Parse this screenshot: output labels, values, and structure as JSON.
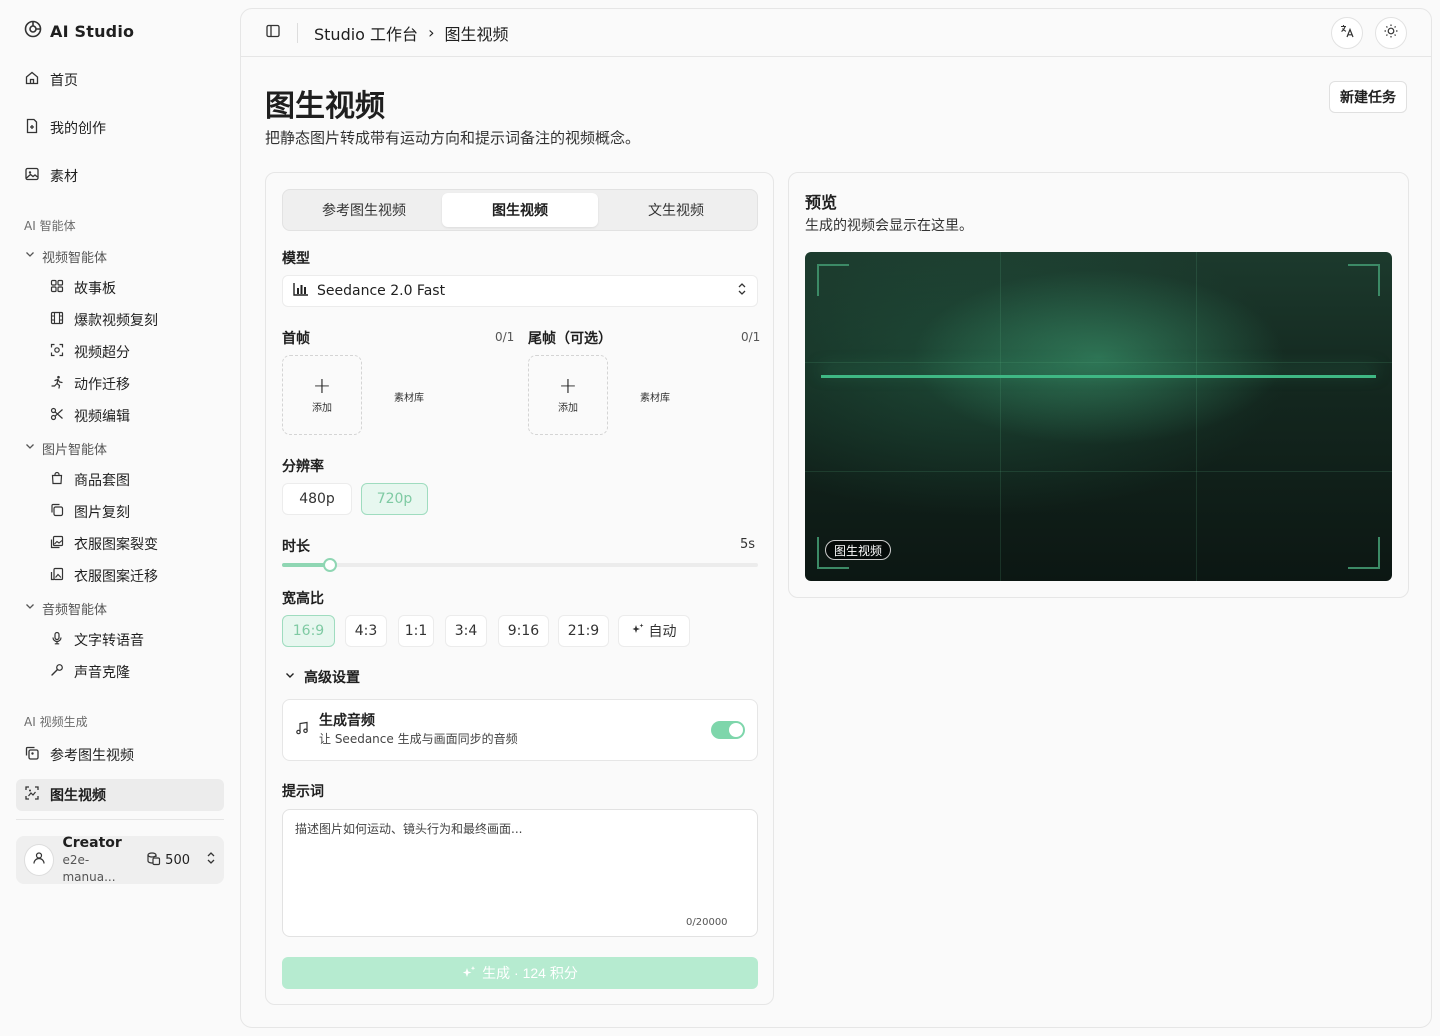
{
  "app": {
    "name": "AI Studio"
  },
  "sidebar": {
    "top_items": [
      {
        "label": "首页",
        "icon": "home-icon"
      },
      {
        "label": "我的创作",
        "icon": "file-icon"
      },
      {
        "label": "素材",
        "icon": "image-icon"
      }
    ],
    "section_ai_agents": "AI 智能体",
    "groups": [
      {
        "label": "视频智能体",
        "items": [
          "故事板",
          "爆款视频复刻",
          "视频超分",
          "动作迁移",
          "视频编辑"
        ]
      },
      {
        "label": "图片智能体",
        "items": [
          "商品套图",
          "图片复刻",
          "衣服图案裂变",
          "衣服图案迁移"
        ]
      },
      {
        "label": "音频智能体",
        "items": [
          "文字转语音",
          "声音克隆"
        ]
      }
    ],
    "section_video_gen": "AI 视频生成",
    "video_gen_items": [
      {
        "label": "参考图生视频",
        "icon": "copy-icon",
        "active": false
      },
      {
        "label": "图生视频",
        "icon": "image-scan-icon",
        "active": true
      }
    ],
    "user": {
      "name": "Creator",
      "email": "e2e-manua...",
      "credits": "500"
    }
  },
  "topbar": {
    "breadcrumb": [
      "Studio 工作台",
      "图生视频"
    ],
    "separator": "›"
  },
  "page": {
    "title": "图生视频",
    "description": "把静态图片转成带有运动方向和提示词备注的视频概念。",
    "new_task_label": "新建任务"
  },
  "form": {
    "tabs": [
      {
        "label": "参考图生视频",
        "active": false
      },
      {
        "label": "图生视频",
        "active": true
      },
      {
        "label": "文生视频",
        "active": false
      }
    ],
    "model_label": "模型",
    "model_value": "Seedance 2.0 Fast",
    "first_frame": {
      "label": "首帧",
      "count": "0/1",
      "add": "添加",
      "library": "素材库"
    },
    "last_frame": {
      "label": "尾帧（可选）",
      "count": "0/1",
      "add": "添加",
      "library": "素材库"
    },
    "resolution_label": "分辨率",
    "resolutions": [
      {
        "label": "480p",
        "selected": false
      },
      {
        "label": "720p",
        "selected": true
      }
    ],
    "duration_label": "时长",
    "duration_value": "5s",
    "duration_fraction": 0.1,
    "aspect_label": "宽高比",
    "aspects": [
      {
        "label": "16:9",
        "selected": true
      },
      {
        "label": "4:3",
        "selected": false
      },
      {
        "label": "1:1",
        "selected": false
      },
      {
        "label": "3:4",
        "selected": false
      },
      {
        "label": "9:16",
        "selected": false
      },
      {
        "label": "21:9",
        "selected": false
      },
      {
        "label": "自动",
        "selected": false
      }
    ],
    "advanced_label": "高级设置",
    "audio": {
      "title": "生成音频",
      "subtitle": "让 Seedance 生成与画面同步的音频",
      "enabled": true
    },
    "prompt_label": "提示词",
    "prompt_placeholder": "描述图片如何运动、镜头行为和最终画面...",
    "prompt_count": "0/20000",
    "generate_label": "生成 · 124 积分"
  },
  "preview": {
    "title": "预览",
    "subtitle": "生成的视频会显示在这里。",
    "badge": "图生视频"
  },
  "colors": {
    "accent": "#7ed6ab",
    "accent_light": "#e7f7ef",
    "video_bg": "#13261e"
  }
}
